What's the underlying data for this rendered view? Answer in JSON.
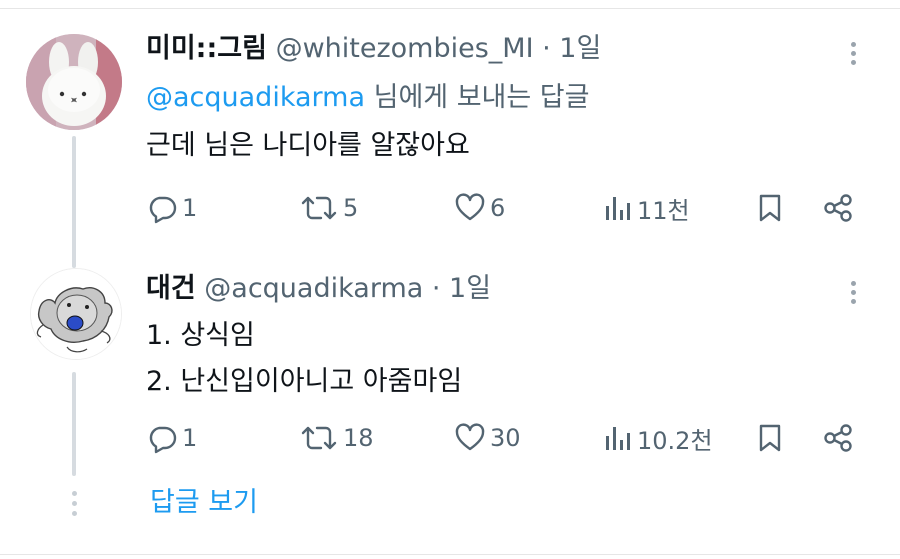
{
  "posts": [
    {
      "author_name": "미미::그림",
      "author_handle": "@whitezombies_MI",
      "time": "· 1일",
      "reply_to_mention": "@acquadikarma",
      "reply_to_suffix": " 님에게 보내는 답글",
      "text_lines": [
        "근데 님은 나디아를 알잖아요"
      ],
      "stats": {
        "replies": "1",
        "reposts": "5",
        "likes": "6",
        "views": "11천"
      },
      "avatar_icon": "white-plush-avatar"
    },
    {
      "author_name": "대건",
      "author_handle": "@acquadikarma",
      "time": "· 1일",
      "text_lines": [
        "1. 상식임",
        "2. 난신입이아니고 아줌마임"
      ],
      "stats": {
        "replies": "1",
        "reposts": "18",
        "likes": "30",
        "views": "10.2천"
      },
      "avatar_icon": "koala-drawing-avatar"
    }
  ],
  "show_replies_label": "답글 보기",
  "colors": {
    "accent": "#1d9bf0",
    "muted": "#536471",
    "text": "#0f1419",
    "thread_line": "#d6dbe0"
  }
}
